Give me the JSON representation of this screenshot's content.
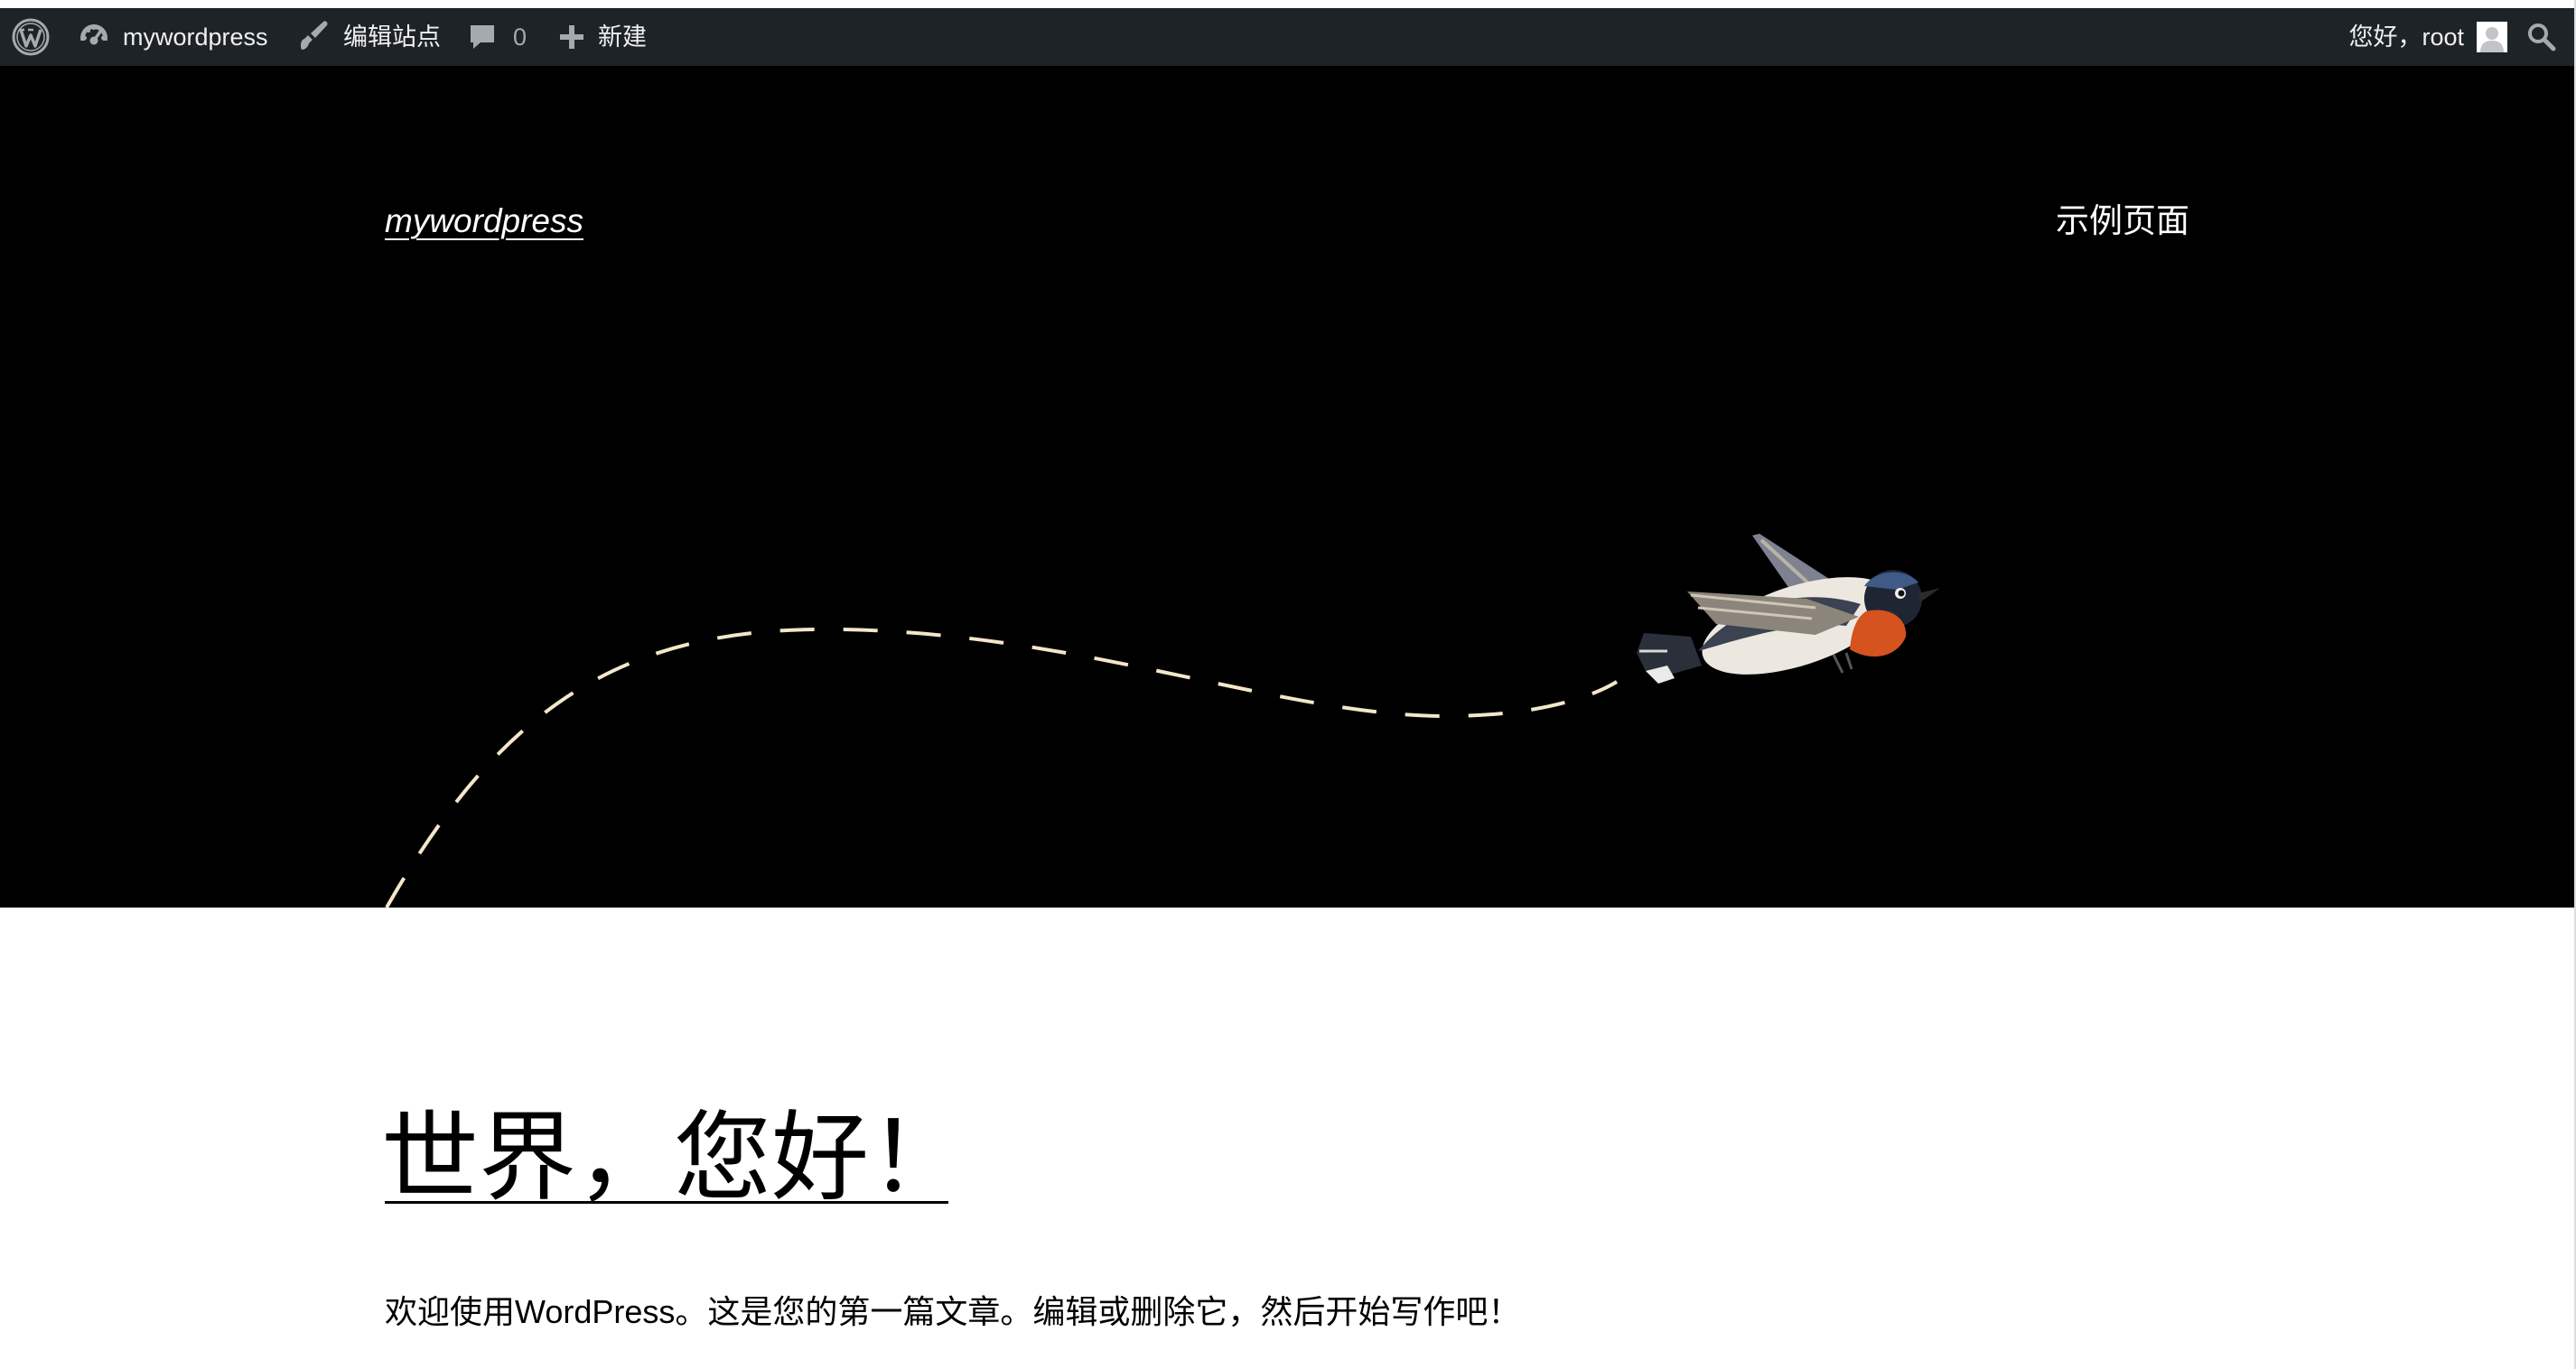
{
  "admin_bar": {
    "site_name": "mywordpress",
    "edit_site": "编辑站点",
    "comments_count": "0",
    "new": "新建",
    "greeting": "您好，root"
  },
  "header": {
    "site_title": "mywordpress",
    "nav_link": "示例页面"
  },
  "post": {
    "title": "世界，您好！",
    "excerpt": "欢迎使用WordPress。这是您的第一篇文章。编辑或删除它，然后开始写作吧！"
  },
  "icons": {
    "wp_logo": "wordpress-logo-icon",
    "dashboard": "dashboard-icon",
    "edit": "brush-icon",
    "comments": "comment-bubble-icon",
    "new": "plus-icon",
    "avatar": "avatar-icon",
    "search": "search-icon",
    "bird": "bird-illustration"
  },
  "colors": {
    "admin_bar_bg": "#1d2327",
    "admin_bar_text": "#f0f0f1",
    "header_bg": "#000000",
    "page_bg": "#ffffff",
    "path_stroke": "#f4e7c9",
    "bird_breast": "#d4531e"
  }
}
